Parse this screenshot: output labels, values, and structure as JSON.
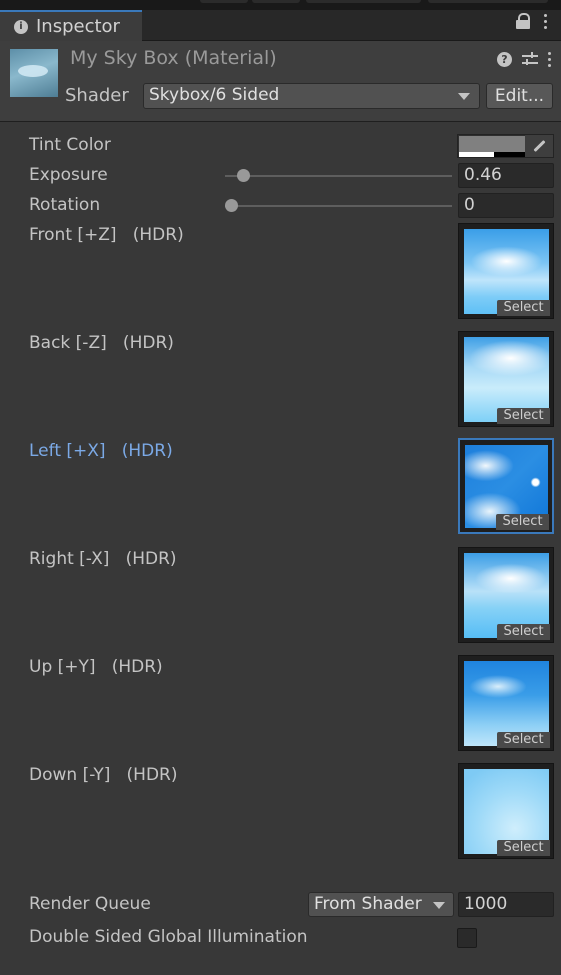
{
  "tab": {
    "title": "Inspector"
  },
  "header": {
    "material_title": "My Sky Box (Material)",
    "shader_label": "Shader",
    "shader_value": "Skybox/6 Sided",
    "edit_label": "Edit..."
  },
  "properties": {
    "tint_label": "Tint Color",
    "tint_color": "#808080",
    "exposure_label": "Exposure",
    "exposure_value": "0.46",
    "rotation_label": "Rotation",
    "rotation_value": "0"
  },
  "textures": [
    {
      "label": "Front [+Z]   (HDR)",
      "select": "Select",
      "active": false
    },
    {
      "label": "Back [-Z]   (HDR)",
      "select": "Select",
      "active": false
    },
    {
      "label": "Left [+X]   (HDR)",
      "select": "Select",
      "active": true
    },
    {
      "label": "Right [-X]   (HDR)",
      "select": "Select",
      "active": false
    },
    {
      "label": "Up [+Y]   (HDR)",
      "select": "Select",
      "active": false
    },
    {
      "label": "Down [-Y]   (HDR)",
      "select": "Select",
      "active": false
    }
  ],
  "footer": {
    "render_queue_label": "Render Queue",
    "render_queue_mode": "From Shader",
    "render_queue_value": "1000",
    "dsgi_label": "Double Sided Global Illumination",
    "dsgi_checked": false
  },
  "colors": {
    "accent": "#3a79bb",
    "active_label": "#7ba9e6",
    "background": "#383838"
  }
}
